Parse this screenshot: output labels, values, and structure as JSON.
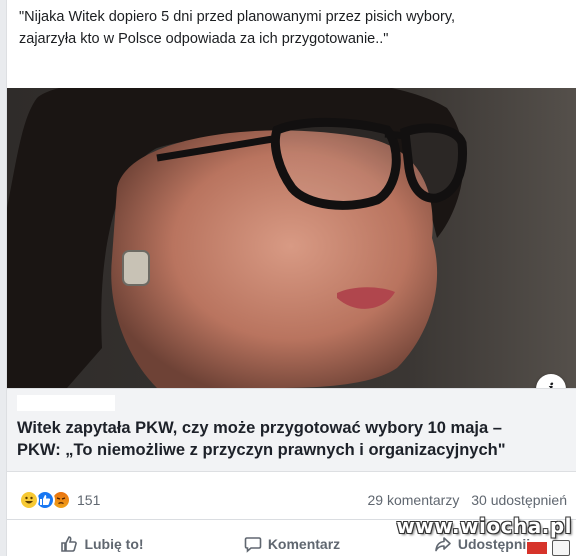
{
  "post": {
    "text": "\"Nijaka Witek dopiero 5 dni przed planowanymi przez pisich wybory,\nzajarzyła kto w Polsce odpowiada za ich przygotowanie..\""
  },
  "link_preview": {
    "info_icon": "i",
    "title_line1": "Witek zapytała PKW, czy może przygotować wybory 10 maja –",
    "title_line2": "PKW: „To niemożliwe z przyczyn prawnych i organizacyjnych\""
  },
  "stats": {
    "reaction_icons": [
      "haha-icon",
      "like-icon",
      "angry-icon"
    ],
    "reaction_count": "151",
    "comments": "29 komentarzy",
    "shares": "30 udostępnień"
  },
  "actions": {
    "like": "Lubię to!",
    "comment": "Komentarz",
    "share": "Udostępnij"
  },
  "watermark": {
    "text": "www.wiocha.pl"
  },
  "colors": {
    "like_blue": "#1877f2",
    "haha_yellow": "#f7c934",
    "angry_orange": "#e9710f",
    "link_box_bg": "#f2f3f5"
  }
}
